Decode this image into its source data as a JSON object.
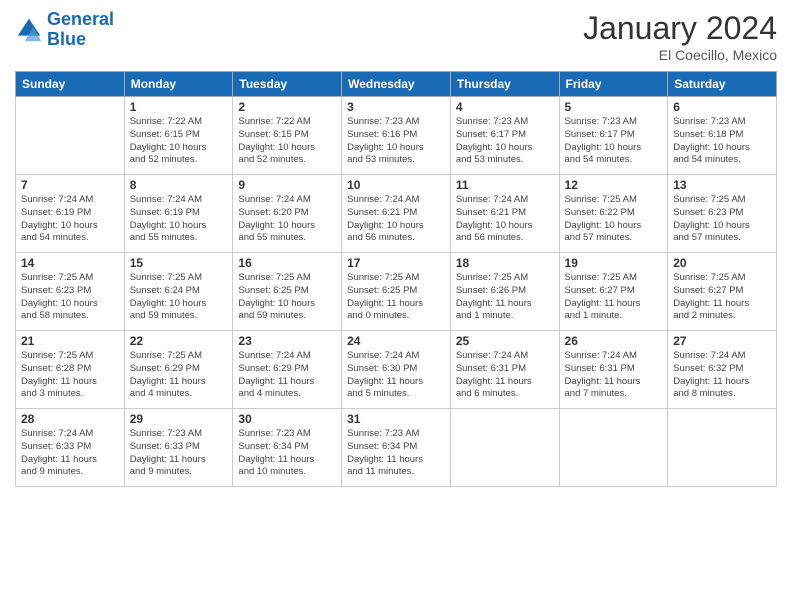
{
  "header": {
    "logo_line1": "General",
    "logo_line2": "Blue",
    "month": "January 2024",
    "location": "El Coecillo, Mexico"
  },
  "days_of_week": [
    "Sunday",
    "Monday",
    "Tuesday",
    "Wednesday",
    "Thursday",
    "Friday",
    "Saturday"
  ],
  "weeks": [
    [
      {
        "day": "",
        "info": ""
      },
      {
        "day": "1",
        "info": "Sunrise: 7:22 AM\nSunset: 6:15 PM\nDaylight: 10 hours\nand 52 minutes."
      },
      {
        "day": "2",
        "info": "Sunrise: 7:22 AM\nSunset: 6:15 PM\nDaylight: 10 hours\nand 52 minutes."
      },
      {
        "day": "3",
        "info": "Sunrise: 7:23 AM\nSunset: 6:16 PM\nDaylight: 10 hours\nand 53 minutes."
      },
      {
        "day": "4",
        "info": "Sunrise: 7:23 AM\nSunset: 6:17 PM\nDaylight: 10 hours\nand 53 minutes."
      },
      {
        "day": "5",
        "info": "Sunrise: 7:23 AM\nSunset: 6:17 PM\nDaylight: 10 hours\nand 54 minutes."
      },
      {
        "day": "6",
        "info": "Sunrise: 7:23 AM\nSunset: 6:18 PM\nDaylight: 10 hours\nand 54 minutes."
      }
    ],
    [
      {
        "day": "7",
        "info": "Sunrise: 7:24 AM\nSunset: 6:19 PM\nDaylight: 10 hours\nand 54 minutes."
      },
      {
        "day": "8",
        "info": "Sunrise: 7:24 AM\nSunset: 6:19 PM\nDaylight: 10 hours\nand 55 minutes."
      },
      {
        "day": "9",
        "info": "Sunrise: 7:24 AM\nSunset: 6:20 PM\nDaylight: 10 hours\nand 55 minutes."
      },
      {
        "day": "10",
        "info": "Sunrise: 7:24 AM\nSunset: 6:21 PM\nDaylight: 10 hours\nand 56 minutes."
      },
      {
        "day": "11",
        "info": "Sunrise: 7:24 AM\nSunset: 6:21 PM\nDaylight: 10 hours\nand 56 minutes."
      },
      {
        "day": "12",
        "info": "Sunrise: 7:25 AM\nSunset: 6:22 PM\nDaylight: 10 hours\nand 57 minutes."
      },
      {
        "day": "13",
        "info": "Sunrise: 7:25 AM\nSunset: 6:23 PM\nDaylight: 10 hours\nand 57 minutes."
      }
    ],
    [
      {
        "day": "14",
        "info": "Sunrise: 7:25 AM\nSunset: 6:23 PM\nDaylight: 10 hours\nand 58 minutes."
      },
      {
        "day": "15",
        "info": "Sunrise: 7:25 AM\nSunset: 6:24 PM\nDaylight: 10 hours\nand 59 minutes."
      },
      {
        "day": "16",
        "info": "Sunrise: 7:25 AM\nSunset: 6:25 PM\nDaylight: 10 hours\nand 59 minutes."
      },
      {
        "day": "17",
        "info": "Sunrise: 7:25 AM\nSunset: 6:25 PM\nDaylight: 11 hours\nand 0 minutes."
      },
      {
        "day": "18",
        "info": "Sunrise: 7:25 AM\nSunset: 6:26 PM\nDaylight: 11 hours\nand 1 minute."
      },
      {
        "day": "19",
        "info": "Sunrise: 7:25 AM\nSunset: 6:27 PM\nDaylight: 11 hours\nand 1 minute."
      },
      {
        "day": "20",
        "info": "Sunrise: 7:25 AM\nSunset: 6:27 PM\nDaylight: 11 hours\nand 2 minutes."
      }
    ],
    [
      {
        "day": "21",
        "info": "Sunrise: 7:25 AM\nSunset: 6:28 PM\nDaylight: 11 hours\nand 3 minutes."
      },
      {
        "day": "22",
        "info": "Sunrise: 7:25 AM\nSunset: 6:29 PM\nDaylight: 11 hours\nand 4 minutes."
      },
      {
        "day": "23",
        "info": "Sunrise: 7:24 AM\nSunset: 6:29 PM\nDaylight: 11 hours\nand 4 minutes."
      },
      {
        "day": "24",
        "info": "Sunrise: 7:24 AM\nSunset: 6:30 PM\nDaylight: 11 hours\nand 5 minutes."
      },
      {
        "day": "25",
        "info": "Sunrise: 7:24 AM\nSunset: 6:31 PM\nDaylight: 11 hours\nand 6 minutes."
      },
      {
        "day": "26",
        "info": "Sunrise: 7:24 AM\nSunset: 6:31 PM\nDaylight: 11 hours\nand 7 minutes."
      },
      {
        "day": "27",
        "info": "Sunrise: 7:24 AM\nSunset: 6:32 PM\nDaylight: 11 hours\nand 8 minutes."
      }
    ],
    [
      {
        "day": "28",
        "info": "Sunrise: 7:24 AM\nSunset: 6:33 PM\nDaylight: 11 hours\nand 9 minutes."
      },
      {
        "day": "29",
        "info": "Sunrise: 7:23 AM\nSunset: 6:33 PM\nDaylight: 11 hours\nand 9 minutes."
      },
      {
        "day": "30",
        "info": "Sunrise: 7:23 AM\nSunset: 6:34 PM\nDaylight: 11 hours\nand 10 minutes."
      },
      {
        "day": "31",
        "info": "Sunrise: 7:23 AM\nSunset: 6:34 PM\nDaylight: 11 hours\nand 11 minutes."
      },
      {
        "day": "",
        "info": ""
      },
      {
        "day": "",
        "info": ""
      },
      {
        "day": "",
        "info": ""
      }
    ]
  ]
}
